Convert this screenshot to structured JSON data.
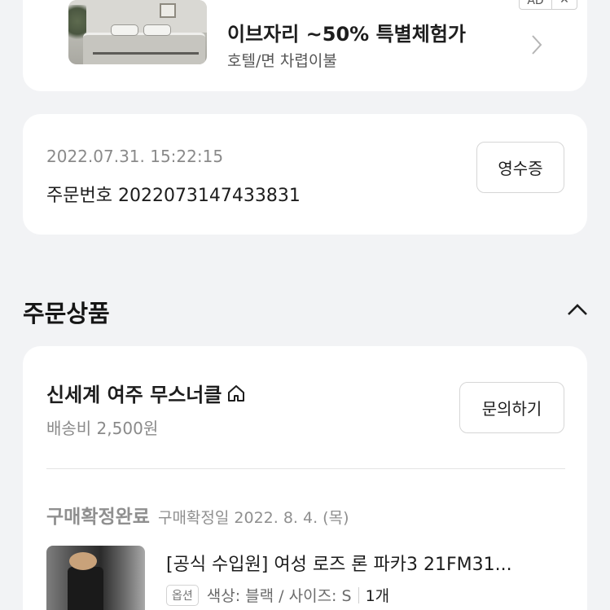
{
  "ad": {
    "title": "이브자리 ~50% 특별체험가",
    "subtitle": "호텔/면 차렵이불",
    "badge": "AD",
    "close": "✕"
  },
  "order": {
    "datetime": "2022.07.31. 15:22:15",
    "number": "주문번호 2022073147433831",
    "receipt_label": "영수증"
  },
  "section": {
    "title": "주문상품"
  },
  "seller": {
    "name": "신세계 여주 무스너클",
    "shipping": "배송비 2,500원",
    "inquiry_label": "문의하기"
  },
  "item": {
    "status": "구매확정완료",
    "confirm_date": "구매확정일 2022. 8. 4. (목)",
    "title": "[공식 수입원] 여성 로즈 론 파카3 21FM31...",
    "option_badge": "옵션",
    "option_text": "색상: 블랙 / 사이즈: S",
    "quantity": "1개"
  },
  "icons": {
    "ad_chevron": "chevron-right-icon",
    "collapse": "chevron-up-icon",
    "store": "home-icon"
  }
}
